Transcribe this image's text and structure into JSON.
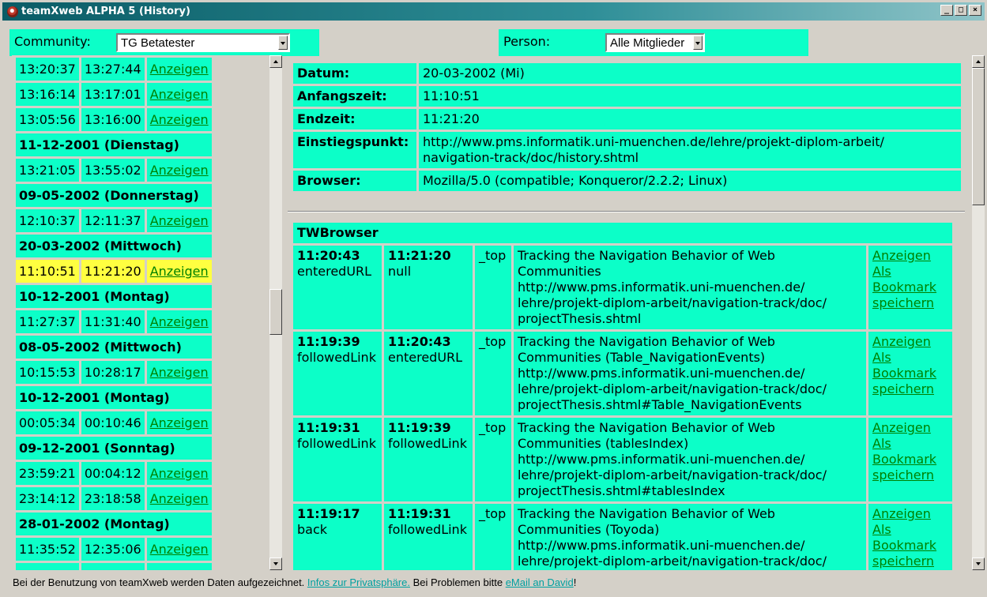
{
  "window": {
    "title": "teamXweb ALPHA 5 (History)",
    "min": "_",
    "max": "□",
    "close": "×"
  },
  "filters": {
    "community_label": "Community:",
    "community_value": "TG Betatester",
    "person_label": "Person:",
    "person_value": "Alle Mitglieder"
  },
  "sessions": [
    {
      "type": "row",
      "start": "13:20:37",
      "end": "13:27:44",
      "link": "Anzeigen"
    },
    {
      "type": "row",
      "start": "13:16:14",
      "end": "13:17:01",
      "link": "Anzeigen"
    },
    {
      "type": "row",
      "start": "13:05:56",
      "end": "13:16:00",
      "link": "Anzeigen"
    },
    {
      "type": "date",
      "label": "11-12-2001 (Dienstag)"
    },
    {
      "type": "row",
      "start": "13:21:05",
      "end": "13:55:02",
      "link": "Anzeigen"
    },
    {
      "type": "date",
      "label": "09-05-2002 (Donnerstag)"
    },
    {
      "type": "row",
      "start": "12:10:37",
      "end": "12:11:37",
      "link": "Anzeigen"
    },
    {
      "type": "date",
      "label": "20-03-2002 (Mittwoch)"
    },
    {
      "type": "row",
      "start": "11:10:51",
      "end": "11:21:20",
      "link": "Anzeigen",
      "selected": true
    },
    {
      "type": "date",
      "label": "10-12-2001 (Montag)"
    },
    {
      "type": "row",
      "start": "11:27:37",
      "end": "11:31:40",
      "link": "Anzeigen"
    },
    {
      "type": "date",
      "label": "08-05-2002 (Mittwoch)"
    },
    {
      "type": "row",
      "start": "10:15:53",
      "end": "10:28:17",
      "link": "Anzeigen"
    },
    {
      "type": "date",
      "label": "10-12-2001 (Montag)"
    },
    {
      "type": "row",
      "start": "00:05:34",
      "end": "00:10:46",
      "link": "Anzeigen"
    },
    {
      "type": "date",
      "label": "09-12-2001 (Sonntag)"
    },
    {
      "type": "row",
      "start": "23:59:21",
      "end": "00:04:12",
      "link": "Anzeigen"
    },
    {
      "type": "row",
      "start": "23:14:12",
      "end": "23:18:58",
      "link": "Anzeigen"
    },
    {
      "type": "date",
      "label": "28-01-2002 (Montag)"
    },
    {
      "type": "row",
      "start": "11:35:52",
      "end": "12:35:06",
      "link": "Anzeigen"
    },
    {
      "type": "row",
      "start": "",
      "end": "",
      "link": ""
    }
  ],
  "details": [
    {
      "key": "Datum:",
      "value": "20-03-2002 (Mi)"
    },
    {
      "key": "Anfangszeit:",
      "value": "11:10:51"
    },
    {
      "key": "Endzeit:",
      "value": "11:21:20"
    },
    {
      "key": "Einstiegspunkt:",
      "value": "http://www.pms.informatik.uni-muenchen.de/lehre/projekt-diplom-arbeit/ navigation-track/doc/history.shtml"
    },
    {
      "key": "Browser:",
      "value": "Mozilla/5.0 (compatible; Konqueror/2.2.2; Linux)"
    }
  ],
  "tracks": {
    "heading": "TWBrowser",
    "rows": [
      {
        "t1": "11:20:43",
        "e1": "enteredURL",
        "t2": "11:21:20",
        "e2": "null",
        "target": "_top",
        "title": "Tracking the Navigation Behavior of Web Communities",
        "url": "http://www.pms.informatik.uni-muenchen.de/ lehre/projekt-diplom-arbeit/navigation-track/doc/ projectThesis.shtml",
        "link1": "Anzeigen",
        "link2": "Als Bookmark speichern"
      },
      {
        "t1": "11:19:39",
        "e1": "followedLink",
        "t2": "11:20:43",
        "e2": "enteredURL",
        "target": "_top",
        "title": "Tracking the Navigation Behavior of Web Communities (Table_NavigationEvents)",
        "url": "http://www.pms.informatik.uni-muenchen.de/ lehre/projekt-diplom-arbeit/navigation-track/doc/ projectThesis.shtml#Table_NavigationEvents",
        "link1": "Anzeigen",
        "link2": "Als Bookmark speichern"
      },
      {
        "t1": "11:19:31",
        "e1": "followedLink",
        "t2": "11:19:39",
        "e2": "followedLink",
        "target": "_top",
        "title": "Tracking the Navigation Behavior of Web Communities (tablesIndex)",
        "url": "http://www.pms.informatik.uni-muenchen.de/ lehre/projekt-diplom-arbeit/navigation-track/doc/ projectThesis.shtml#tablesIndex",
        "link1": "Anzeigen",
        "link2": "Als Bookmark speichern"
      },
      {
        "t1": "11:19:17",
        "e1": "back",
        "t2": "11:19:31",
        "e2": "followedLink",
        "target": "_top",
        "title": "Tracking the Navigation Behavior of Web Communities (Toyoda)",
        "url": "http://www.pms.informatik.uni-muenchen.de/ lehre/projekt-diplom-arbeit/navigation-track/doc/",
        "link1": "Anzeigen",
        "link2": "Als Bookmark speichern"
      }
    ]
  },
  "footer": {
    "text1": "Bei der Benutzung von teamXweb werden Daten aufgezeichnet.",
    "link1": "Infos zur Privatsphäre.",
    "text2": "Bei Problemen bitte",
    "link2": "eMail an David",
    "text3": "!"
  }
}
